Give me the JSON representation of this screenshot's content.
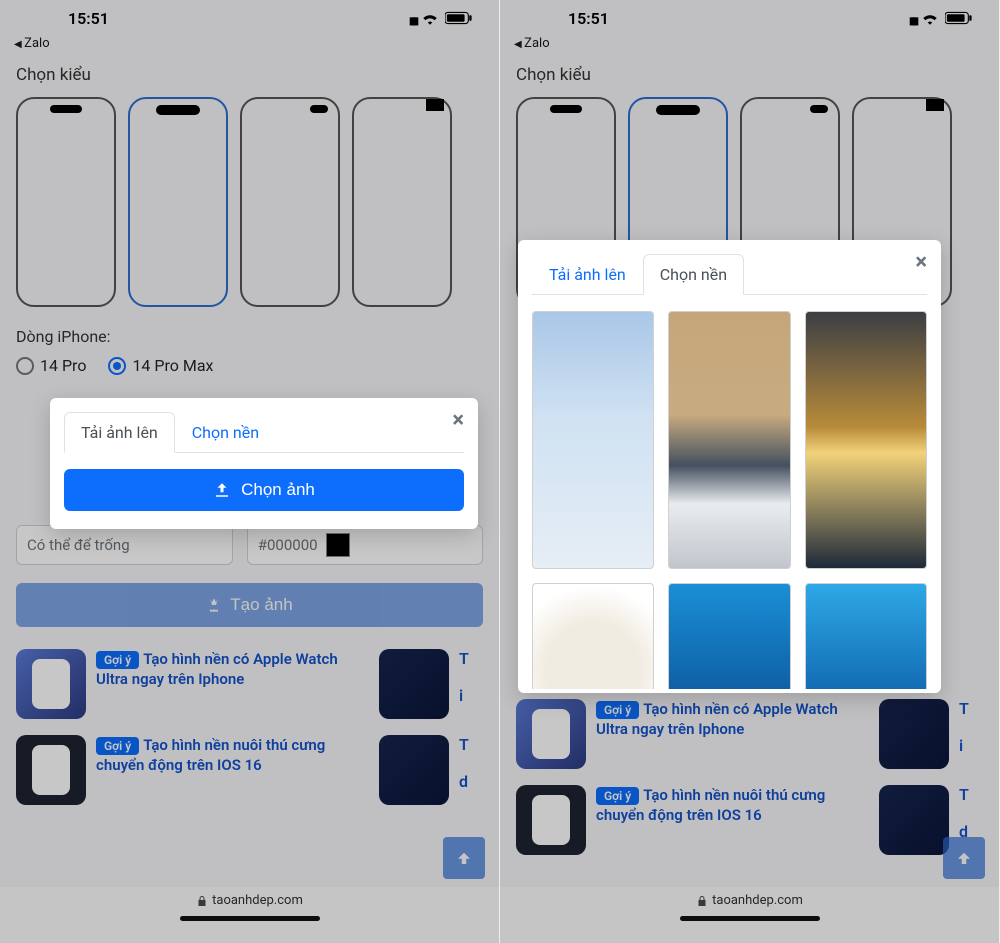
{
  "statusbar": {
    "time": "15:51",
    "back_app": "Zalo"
  },
  "page": {
    "style_title": "Chọn kiểu",
    "iphone_label": "Dòng iPhone:",
    "radio1": "14 Pro",
    "radio2": "14 Pro Max",
    "input_placeholder": "Có thể để trống",
    "color_value": "#000000",
    "create_btn": "Tạo ảnh",
    "back_to_top_aria": "back-to-top"
  },
  "modal_left": {
    "tab_upload": "Tải ảnh lên",
    "tab_choose": "Chọn nền",
    "choose_btn": "Chọn ảnh",
    "close": "×"
  },
  "modal_right": {
    "tab_upload": "Tải ảnh lên",
    "tab_choose": "Chọn nền",
    "close": "×"
  },
  "suggestions": {
    "badge": "Gợi ý",
    "item1": "Tạo hình nền có Apple Watch Ultra ngay trên Iphone",
    "item2": "Tạo hình nền nuôi thú cưng chuyển động trên IOS 16",
    "cut_text1": "T",
    "cut_text2": "i",
    "cut_text3": "T",
    "cut_text4": "d"
  },
  "footer": {
    "url": "taoanhdep.com"
  }
}
